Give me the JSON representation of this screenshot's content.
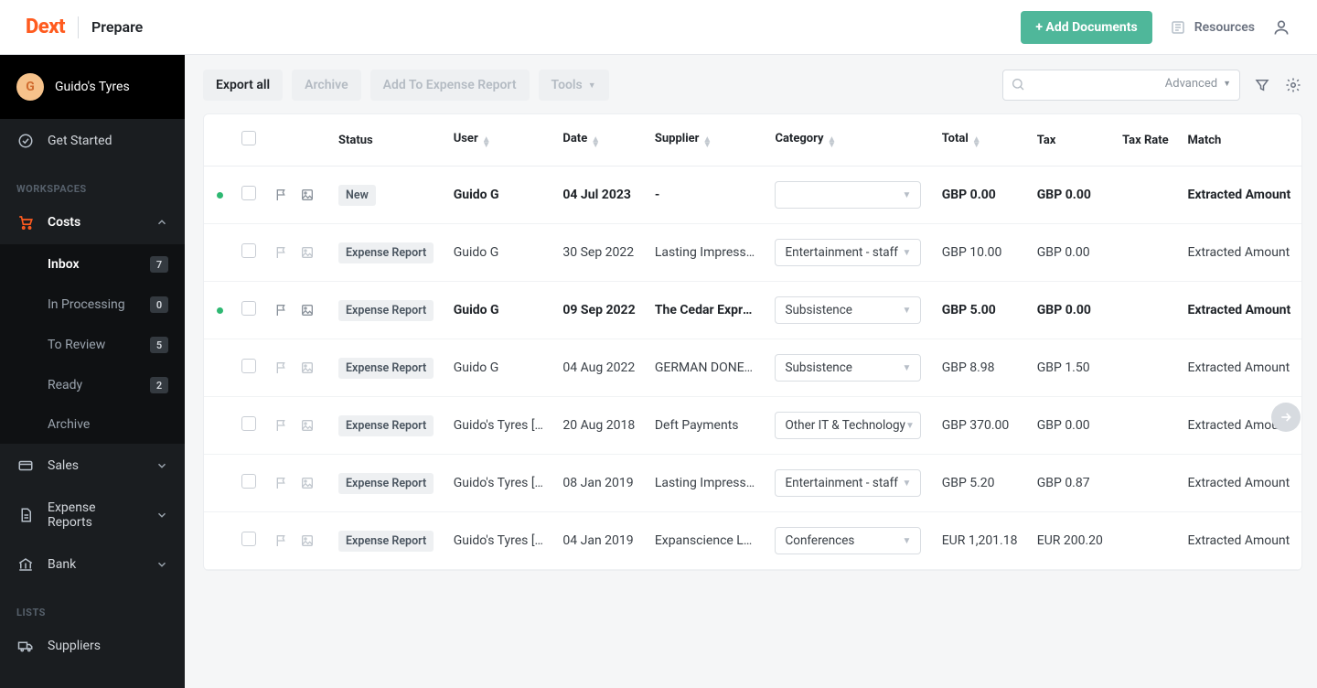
{
  "header": {
    "brand": "Dext",
    "product": "Prepare",
    "add_documents": "+ Add Documents",
    "resources": "Resources"
  },
  "account": {
    "initial": "G",
    "name": "Guido's Tyres"
  },
  "sidebar": {
    "get_started": "Get Started",
    "workspaces_heading": "WORKSPACES",
    "lists_heading": "LISTS",
    "costs": {
      "label": "Costs"
    },
    "costs_children": [
      {
        "label": "Inbox",
        "count": "7",
        "active": true
      },
      {
        "label": "In Processing",
        "count": "0"
      },
      {
        "label": "To Review",
        "count": "5"
      },
      {
        "label": "Ready",
        "count": "2"
      },
      {
        "label": "Archive",
        "count": ""
      }
    ],
    "sales": "Sales",
    "expense_reports": "Expense Reports",
    "bank": "Bank",
    "suppliers": "Suppliers"
  },
  "toolbar": {
    "export_all": "Export all",
    "archive": "Archive",
    "add_to_expense": "Add To Expense Report",
    "tools": "Tools",
    "advanced": "Advanced",
    "search_placeholder": ""
  },
  "table": {
    "headers": {
      "status": "Status",
      "user": "User",
      "date": "Date",
      "supplier": "Supplier",
      "category": "Category",
      "total": "Total",
      "tax": "Tax",
      "tax_rate": "Tax Rate",
      "match": "Match"
    },
    "rows": [
      {
        "dot": true,
        "bold": true,
        "status": "New",
        "user": "Guido G",
        "date": "04 Jul 2023",
        "supplier": "-",
        "category": "",
        "total": "GBP 0.00",
        "tax": "GBP 0.00",
        "tax_rate": "",
        "match": "Extracted Amount"
      },
      {
        "dot": false,
        "bold": false,
        "status": "Expense Report",
        "user": "Guido G",
        "date": "30 Sep 2022",
        "supplier": "Lasting Impressions",
        "category": "Entertainment - staff",
        "total": "GBP 10.00",
        "tax": "GBP 0.00",
        "tax_rate": "",
        "match": "Extracted Amount"
      },
      {
        "dot": true,
        "bold": true,
        "status": "Expense Report",
        "user": "Guido G",
        "date": "09 Sep 2022",
        "supplier": "The Cedar Express …",
        "category": "Subsistence",
        "total": "GBP 5.00",
        "tax": "GBP 0.00",
        "tax_rate": "",
        "match": "Extracted Amount"
      },
      {
        "dot": false,
        "bold": false,
        "status": "Expense Report",
        "user": "Guido G",
        "date": "04 Aug 2022",
        "supplier": "GERMAN DONER KE…",
        "category": "Subsistence",
        "total": "GBP 8.98",
        "tax": "GBP 1.50",
        "tax_rate": "",
        "match": "Extracted Amount"
      },
      {
        "dot": false,
        "bold": false,
        "status": "Expense Report",
        "user": "Guido's Tyres […",
        "date": "20 Aug 2018",
        "supplier": "Deft Payments",
        "category": "Other IT & Technology",
        "total": "GBP 370.00",
        "tax": "GBP 0.00",
        "tax_rate": "",
        "match": "Extracted Amount"
      },
      {
        "dot": false,
        "bold": false,
        "status": "Expense Report",
        "user": "Guido's Tyres […",
        "date": "08 Jan 2019",
        "supplier": "Lasting Impressions",
        "category": "Entertainment - staff",
        "total": "GBP 5.20",
        "tax": "GBP 0.87",
        "tax_rate": "",
        "match": "Extracted Amount"
      },
      {
        "dot": false,
        "bold": false,
        "status": "Expense Report",
        "user": "Guido's Tyres […",
        "date": "04 Jan 2019",
        "supplier": "Expanscience Labor…",
        "category": "Conferences",
        "total": "EUR 1,201.18",
        "tax": "EUR 200.20",
        "tax_rate": "",
        "match": "Extracted Amount"
      }
    ]
  }
}
